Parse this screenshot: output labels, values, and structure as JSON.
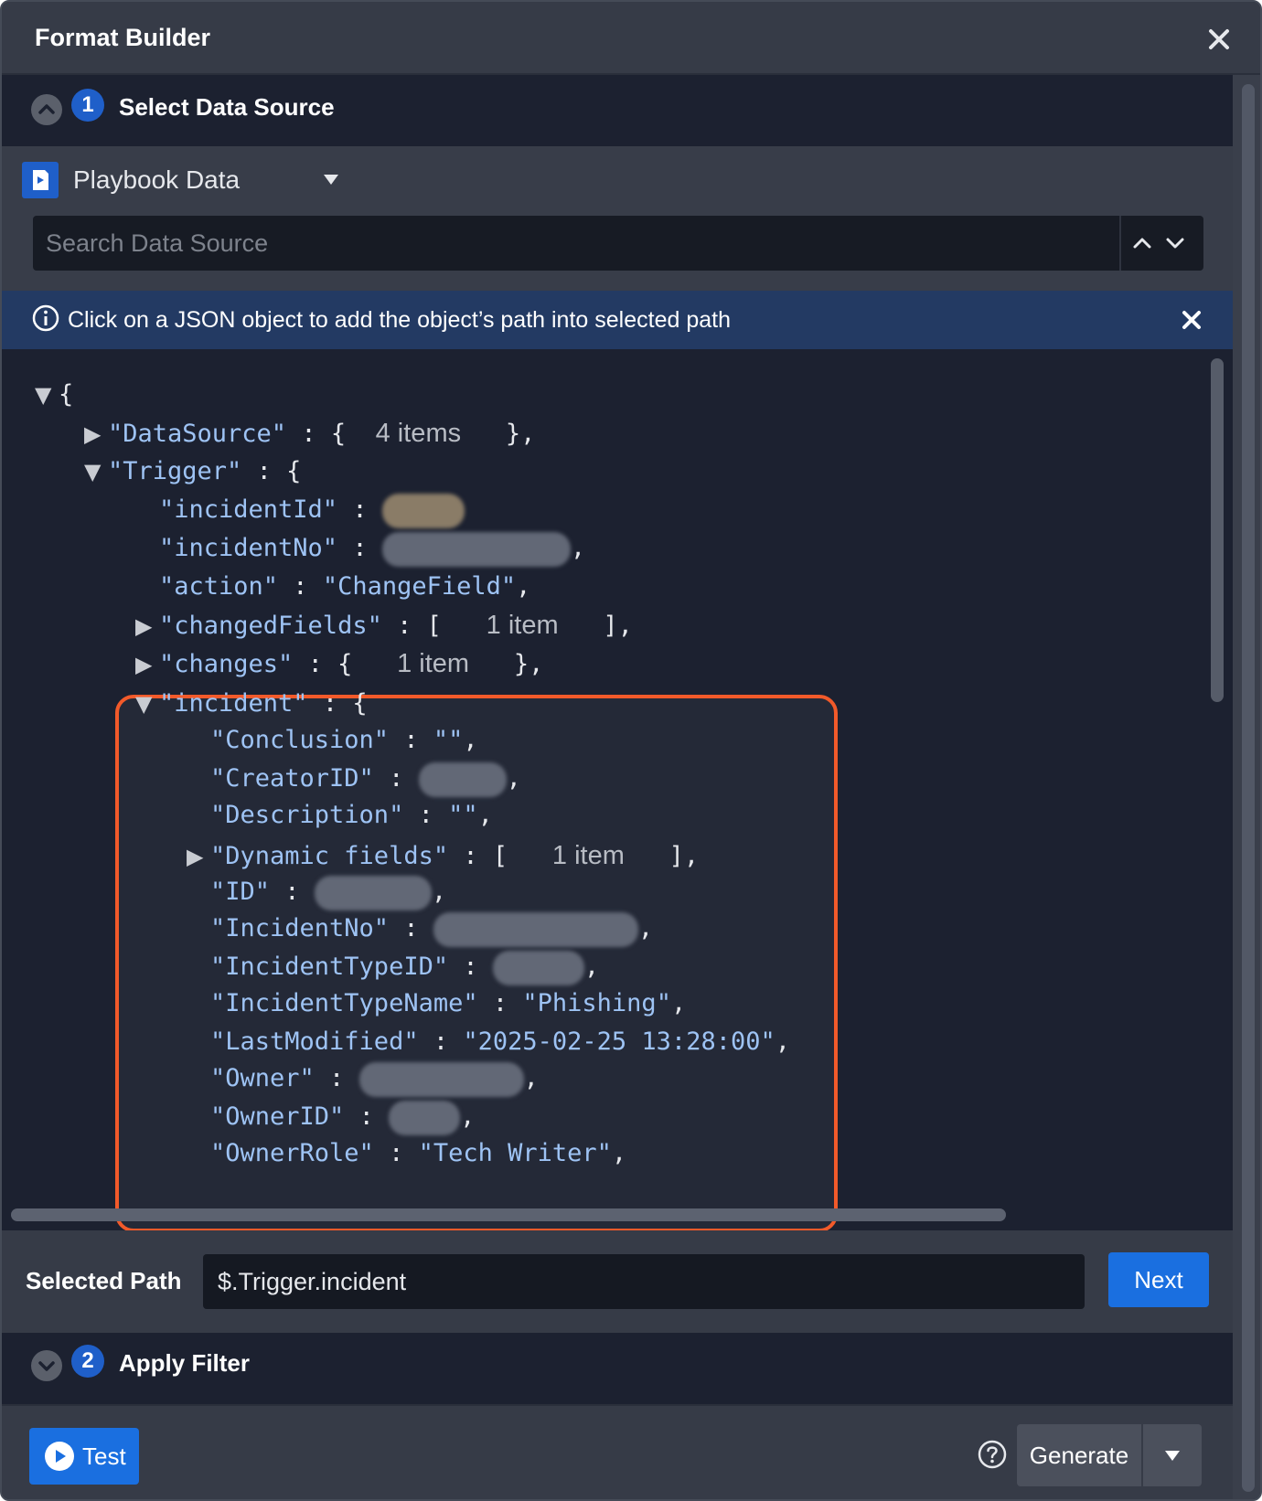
{
  "dialog": {
    "title": "Format Builder"
  },
  "section1": {
    "number": "1",
    "title": "Select Data Source",
    "source_label": "Playbook Data",
    "search_placeholder": "Search Data Source"
  },
  "info": {
    "text": "Click on a JSON object to add the object’s path into selected path"
  },
  "tree": {
    "open_brace": "{",
    "datasource_key": "\"DataSource\"",
    "datasource_count": "4 items",
    "trigger_key": "\"Trigger\"",
    "incidentId_key": "\"incidentId\"",
    "incidentNo_key": "\"incidentNo\"",
    "action_key": "\"action\"",
    "action_value": "\"ChangeField\"",
    "changedFields_key": "\"changedFields\"",
    "changedFields_count": "1 item",
    "changes_key": "\"changes\"",
    "changes_count": "1 item",
    "incident_key": "\"incident\"",
    "conclusion_key": "\"Conclusion\"",
    "conclusion_value": "\"\"",
    "creatorId_key": "\"CreatorID\"",
    "description_key": "\"Description\"",
    "description_value": "\"\"",
    "dynamic_key": "\"Dynamic fields\"",
    "dynamic_count": "1 item",
    "id_key": "\"ID\"",
    "incidentNo2_key": "\"IncidentNo\"",
    "incidentTypeId_key": "\"IncidentTypeID\"",
    "incidentTypeName_key": "\"IncidentTypeName\"",
    "incidentTypeName_value": "\"Phishing\"",
    "lastModified_key": "\"LastModified\"",
    "lastModified_value": "\"2025-02-25 13:28:00\"",
    "owner_key": "\"Owner\"",
    "ownerId_key": "\"OwnerID\"",
    "ownerRole_key": "\"OwnerRole\"",
    "ownerRole_value": "\"Tech Writer\""
  },
  "selected_path": {
    "label": "Selected Path",
    "value": "$.Trigger.incident",
    "next_label": "Next"
  },
  "section2": {
    "number": "2",
    "title": "Apply Filter"
  },
  "footer": {
    "test_label": "Test",
    "generate_label": "Generate"
  },
  "colors": {
    "accent": "#1a6fe0",
    "highlight": "#f25a2a",
    "json_key": "#9ec3f4",
    "banner": "#233a63"
  },
  "icons": [
    "close-icon",
    "chevron-up-icon",
    "chevron-down-icon",
    "playbook-icon",
    "caret-down-icon",
    "info-icon",
    "play-icon",
    "help-icon"
  ]
}
